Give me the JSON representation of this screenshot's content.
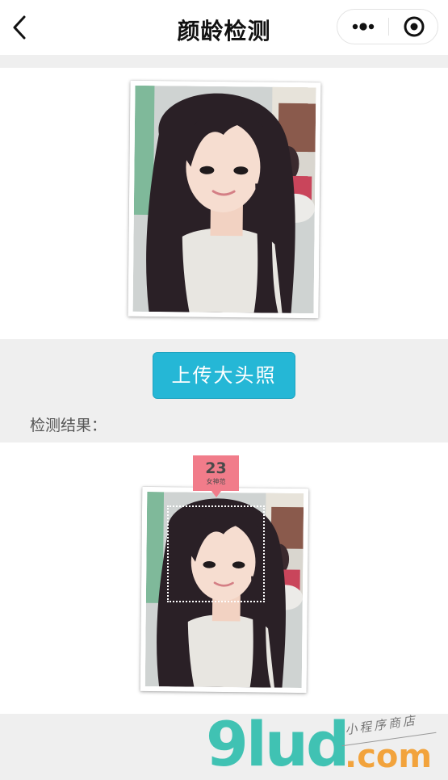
{
  "nav": {
    "title": "颜龄检测",
    "back_icon": "chevron-left-icon",
    "more_icon": "more-dots-icon",
    "close_icon": "target-circle-icon"
  },
  "upload": {
    "button_label": "上传大头照"
  },
  "result": {
    "label": "检测结果：",
    "age": "23",
    "tag": "女神范"
  },
  "watermark": {
    "main": "9lud",
    "sub": ".com",
    "small": "小程序商店"
  },
  "colors": {
    "nav_bg": "#ffffff",
    "page_bg": "#efefef",
    "button_accent": "#25b7d6",
    "age_badge": "#f17c8a",
    "watermark_teal": "#40c2b3",
    "watermark_orange": "#f2a33c"
  }
}
